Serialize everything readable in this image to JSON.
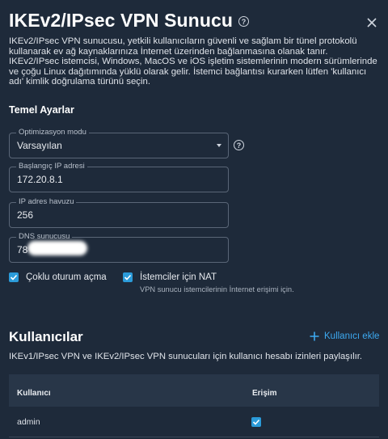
{
  "dialog": {
    "title": "IKEv2/IPsec VPN Sunucu",
    "description": "IKEv2/IPsec VPN sunucusu, yetkili kullanıcıların güvenli ve sağlam bir tünel protokolü kullanarak ev ağ kaynaklarınıza İnternet üzerinden bağlanmasına olanak tanır. IKEv2/IPsec istemcisi, Windows, MacOS ve iOS işletim sistemlerinin modern sürümlerinde ve çoğu Linux dağıtımında yüklü olarak gelir. İstemci bağlantısı kurarken lütfen 'kullanıcı adı' kimlik doğrulama türünü seçin."
  },
  "basic": {
    "heading": "Temel Ayarlar",
    "optimization_label": "Optimizasyon modu",
    "optimization_value": "Varsayılan",
    "start_ip_label": "Başlangıç IP adresi",
    "start_ip_value": "172.20.8.1",
    "pool_label": "IP adres havuzu",
    "pool_value": "256",
    "dns_label": "DNS sunucusu",
    "dns_value": "78",
    "multi_session_label": "Çoklu oturum açma",
    "multi_session_checked": true,
    "nat_label": "İstemciler için NAT",
    "nat_checked": true,
    "nat_sub": "VPN sunucu istemcilerinin İnternet erişimi için."
  },
  "users": {
    "heading": "Kullanıcılar",
    "add_label": "Kullanıcı ekle",
    "description": "IKEv1/IPsec VPN ve IKEv2/IPsec VPN sunucuları için kullanıcı hesabı izinleri paylaşılır.",
    "columns": [
      "Kullanıcı",
      "Erişim"
    ],
    "rows": [
      {
        "user": "admin",
        "access": true
      }
    ]
  },
  "colors": {
    "background": "#1e2a3a",
    "accent": "#2b9bd9",
    "link": "#3da9f0"
  }
}
